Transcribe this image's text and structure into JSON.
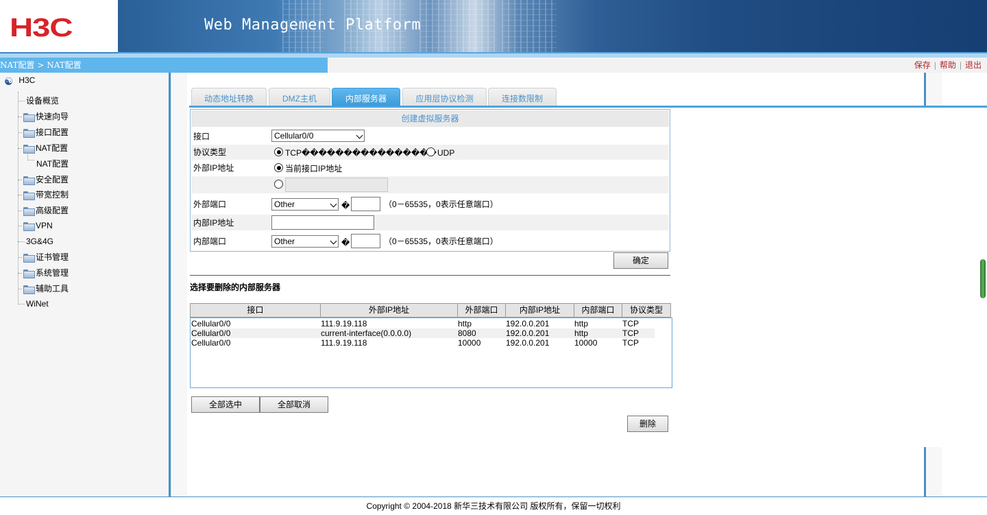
{
  "header": {
    "logo": "H3C",
    "title": "Web Management Platform"
  },
  "navbar": {
    "breadcrumb": "NAT配置 > NAT配置",
    "links": {
      "save": "保存",
      "help": "帮助",
      "logout": "退出"
    }
  },
  "sidebar": {
    "root": "H3C",
    "items": [
      {
        "label": "设备概览",
        "folder": false
      },
      {
        "label": "快速向导",
        "folder": true
      },
      {
        "label": "接口配置",
        "folder": true
      },
      {
        "label": "NAT配置",
        "folder": true
      },
      {
        "label": "安全配置",
        "folder": true
      },
      {
        "label": "带宽控制",
        "folder": true
      },
      {
        "label": "高级配置",
        "folder": true
      },
      {
        "label": "VPN",
        "folder": true
      },
      {
        "label": "3G&4G",
        "folder": false
      },
      {
        "label": "证书管理",
        "folder": true
      },
      {
        "label": "系统管理",
        "folder": true
      },
      {
        "label": "辅助工具",
        "folder": true
      },
      {
        "label": "WiNet",
        "folder": false
      }
    ],
    "subitem": "NAT配置"
  },
  "tabs": [
    {
      "label": "动态地址转换",
      "active": false
    },
    {
      "label": "DMZ主机",
      "active": false
    },
    {
      "label": "内部服务器",
      "active": true
    },
    {
      "label": "应用层协议检测",
      "active": false
    },
    {
      "label": "连接数限制",
      "active": false
    }
  ],
  "form": {
    "title": "创建虚拟服务器",
    "interface_label": "接口",
    "interface_value": "Cellular0/0",
    "protocol_label": "协议类型",
    "protocol_tcp": "TCP����������������",
    "protocol_udp": "UDP",
    "ext_ip_label": "外部IP地址",
    "ext_ip_current": "当前接口IP地址",
    "ext_port_label": "外部端口",
    "ext_port_select": "Other",
    "ext_port_mark": "�",
    "ext_port_hint": "（0－65535，0表示任意端口）",
    "int_ip_label": "内部IP地址",
    "int_port_label": "内部端口",
    "int_port_select": "Other",
    "int_port_mark": "�",
    "int_port_hint": "（0－65535，0表示任意端口）",
    "confirm": "确定"
  },
  "delete_section": {
    "title": "选择要删除的内部服务器",
    "columns": [
      "接口",
      "外部IP地址",
      "外部端口",
      "内部IP地址",
      "内部端口",
      "协议类型"
    ],
    "rows": [
      [
        "Cellular0/0",
        "111.9.19.118",
        "http",
        "192.0.0.201",
        "http",
        "TCP"
      ],
      [
        "Cellular0/0",
        "current-interface(0.0.0.0)",
        "8080",
        "192.0.0.201",
        "http",
        "TCP"
      ],
      [
        "Cellular0/0",
        "111.9.19.118",
        "10000",
        "192.0.0.201",
        "10000",
        "TCP"
      ]
    ],
    "select_all": "全部选中",
    "deselect_all": "全部取消",
    "delete": "删除"
  },
  "footer": "Copyright © 2004-2018 新华三技术有限公司 版权所有，保留一切权利",
  "colors": {
    "accent": "#4aa3df",
    "brand_red": "#d8232a",
    "link_red": "#b2262a"
  }
}
